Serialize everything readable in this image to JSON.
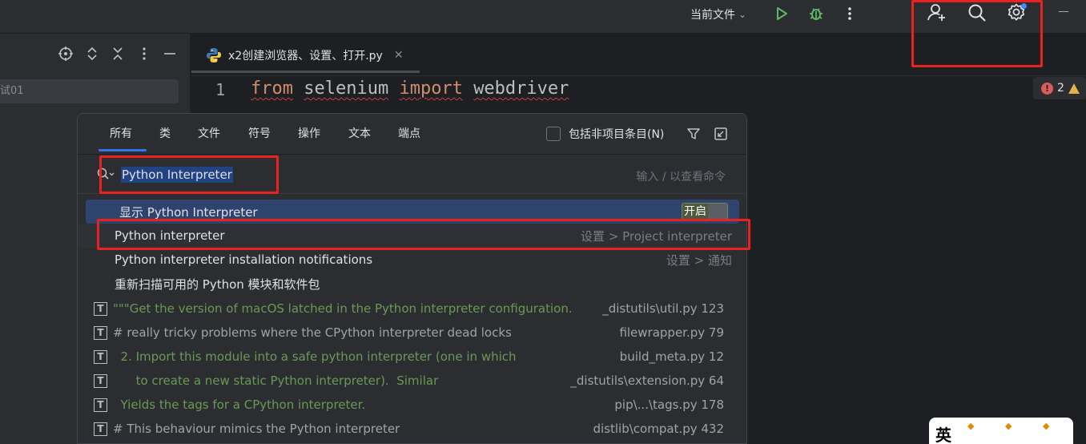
{
  "toolbar": {
    "run_config_label": "当前文件"
  },
  "left_panel": {
    "selected_item": "试01"
  },
  "editor": {
    "tab_label": "x2创建浏览器、设置、打开.py",
    "line_number": "1",
    "code_tokens": [
      "from",
      "selenium",
      "import",
      "webdriver"
    ],
    "error_count": "2"
  },
  "search_popup": {
    "tabs": [
      "所有",
      "类",
      "文件",
      "符号",
      "操作",
      "文本",
      "端点"
    ],
    "include_non_project_label": "包括非项目条目(N)",
    "query": "Python Interpreter",
    "hint": "输入 / 以查看命令",
    "results": [
      {
        "label": "显示 Python Interpreter",
        "toggle": "开启"
      },
      {
        "label": "Python interpreter",
        "location": "设置 > Project interpreter"
      },
      {
        "label": "Python interpreter installation notifications",
        "location": "设置 > 通知"
      },
      {
        "label": "重新扫描可用的 Python 模块和软件包",
        "location": ""
      }
    ],
    "text_results": [
      {
        "text": "\"\"\"Get the version of macOS latched in the Python interpreter configuration.",
        "file": "_distutils\\util.py 123",
        "style": "green"
      },
      {
        "text": "# really tricky problems where the CPython interpreter dead locks",
        "file": "filewrapper.py 79",
        "style": "gray"
      },
      {
        "text": "  2. Import this module into a safe python interpreter (one in which",
        "file": "build_meta.py 12",
        "style": "green"
      },
      {
        "text": "      to create a new static Python interpreter).  Similar",
        "file": "_distutils\\extension.py 64",
        "style": "green"
      },
      {
        "text": "  Yields the tags for a CPython interpreter.",
        "file": "pip\\...\\tags.py 178",
        "style": "green"
      },
      {
        "text": "# This behaviour mimics the Python interpreter",
        "file": "distlib\\compat.py 432",
        "style": "gray"
      }
    ]
  },
  "ime": {
    "lang": "英"
  },
  "colors": {
    "accent": "#3574f0",
    "annotation": "#e8231f",
    "keyword": "#cf8e6d",
    "doc_text": "#6a9955"
  }
}
